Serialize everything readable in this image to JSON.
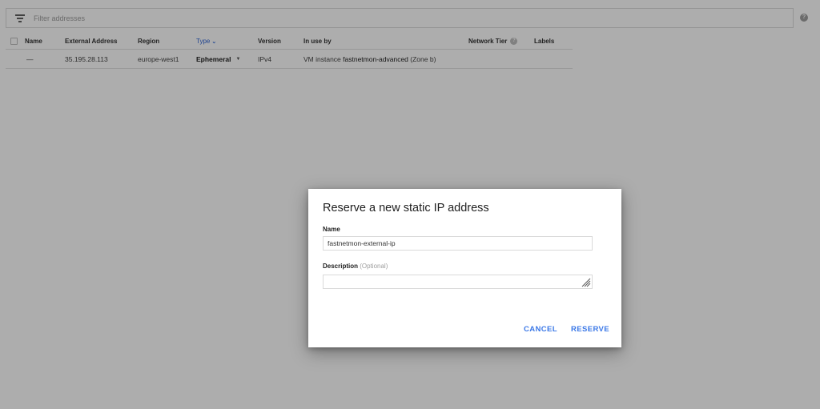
{
  "filter": {
    "placeholder": "Filter addresses"
  },
  "table": {
    "headers": {
      "name": "Name",
      "external_address": "External Address",
      "region": "Region",
      "type": "Type",
      "version": "Version",
      "in_use_by": "In use by",
      "network_tier": "Network Tier",
      "labels": "Labels"
    },
    "rows": [
      {
        "name": "—",
        "external_address": "35.195.28.113",
        "region": "europe-west1",
        "type": "Ephemeral",
        "version": "IPv4",
        "in_use_by_prefix": "VM instance",
        "in_use_by_vm": "fastnetmon-advanced",
        "in_use_by_zone": "(Zone b)"
      }
    ]
  },
  "dialog": {
    "title": "Reserve a new static IP address",
    "name_label": "Name",
    "name_value": "fastnetmon-external-ip",
    "description_label": "Description",
    "description_optional": "(Optional)",
    "cancel_label": "CANCEL",
    "reserve_label": "RESERVE"
  },
  "colors": {
    "accent": "#3b78e7",
    "overlay": "rgba(0,0,0,0.32)"
  },
  "icons": [
    "filter-icon",
    "help-icon",
    "sort-down-icon",
    "dropdown-caret-icon",
    "resize-grip-icon"
  ]
}
